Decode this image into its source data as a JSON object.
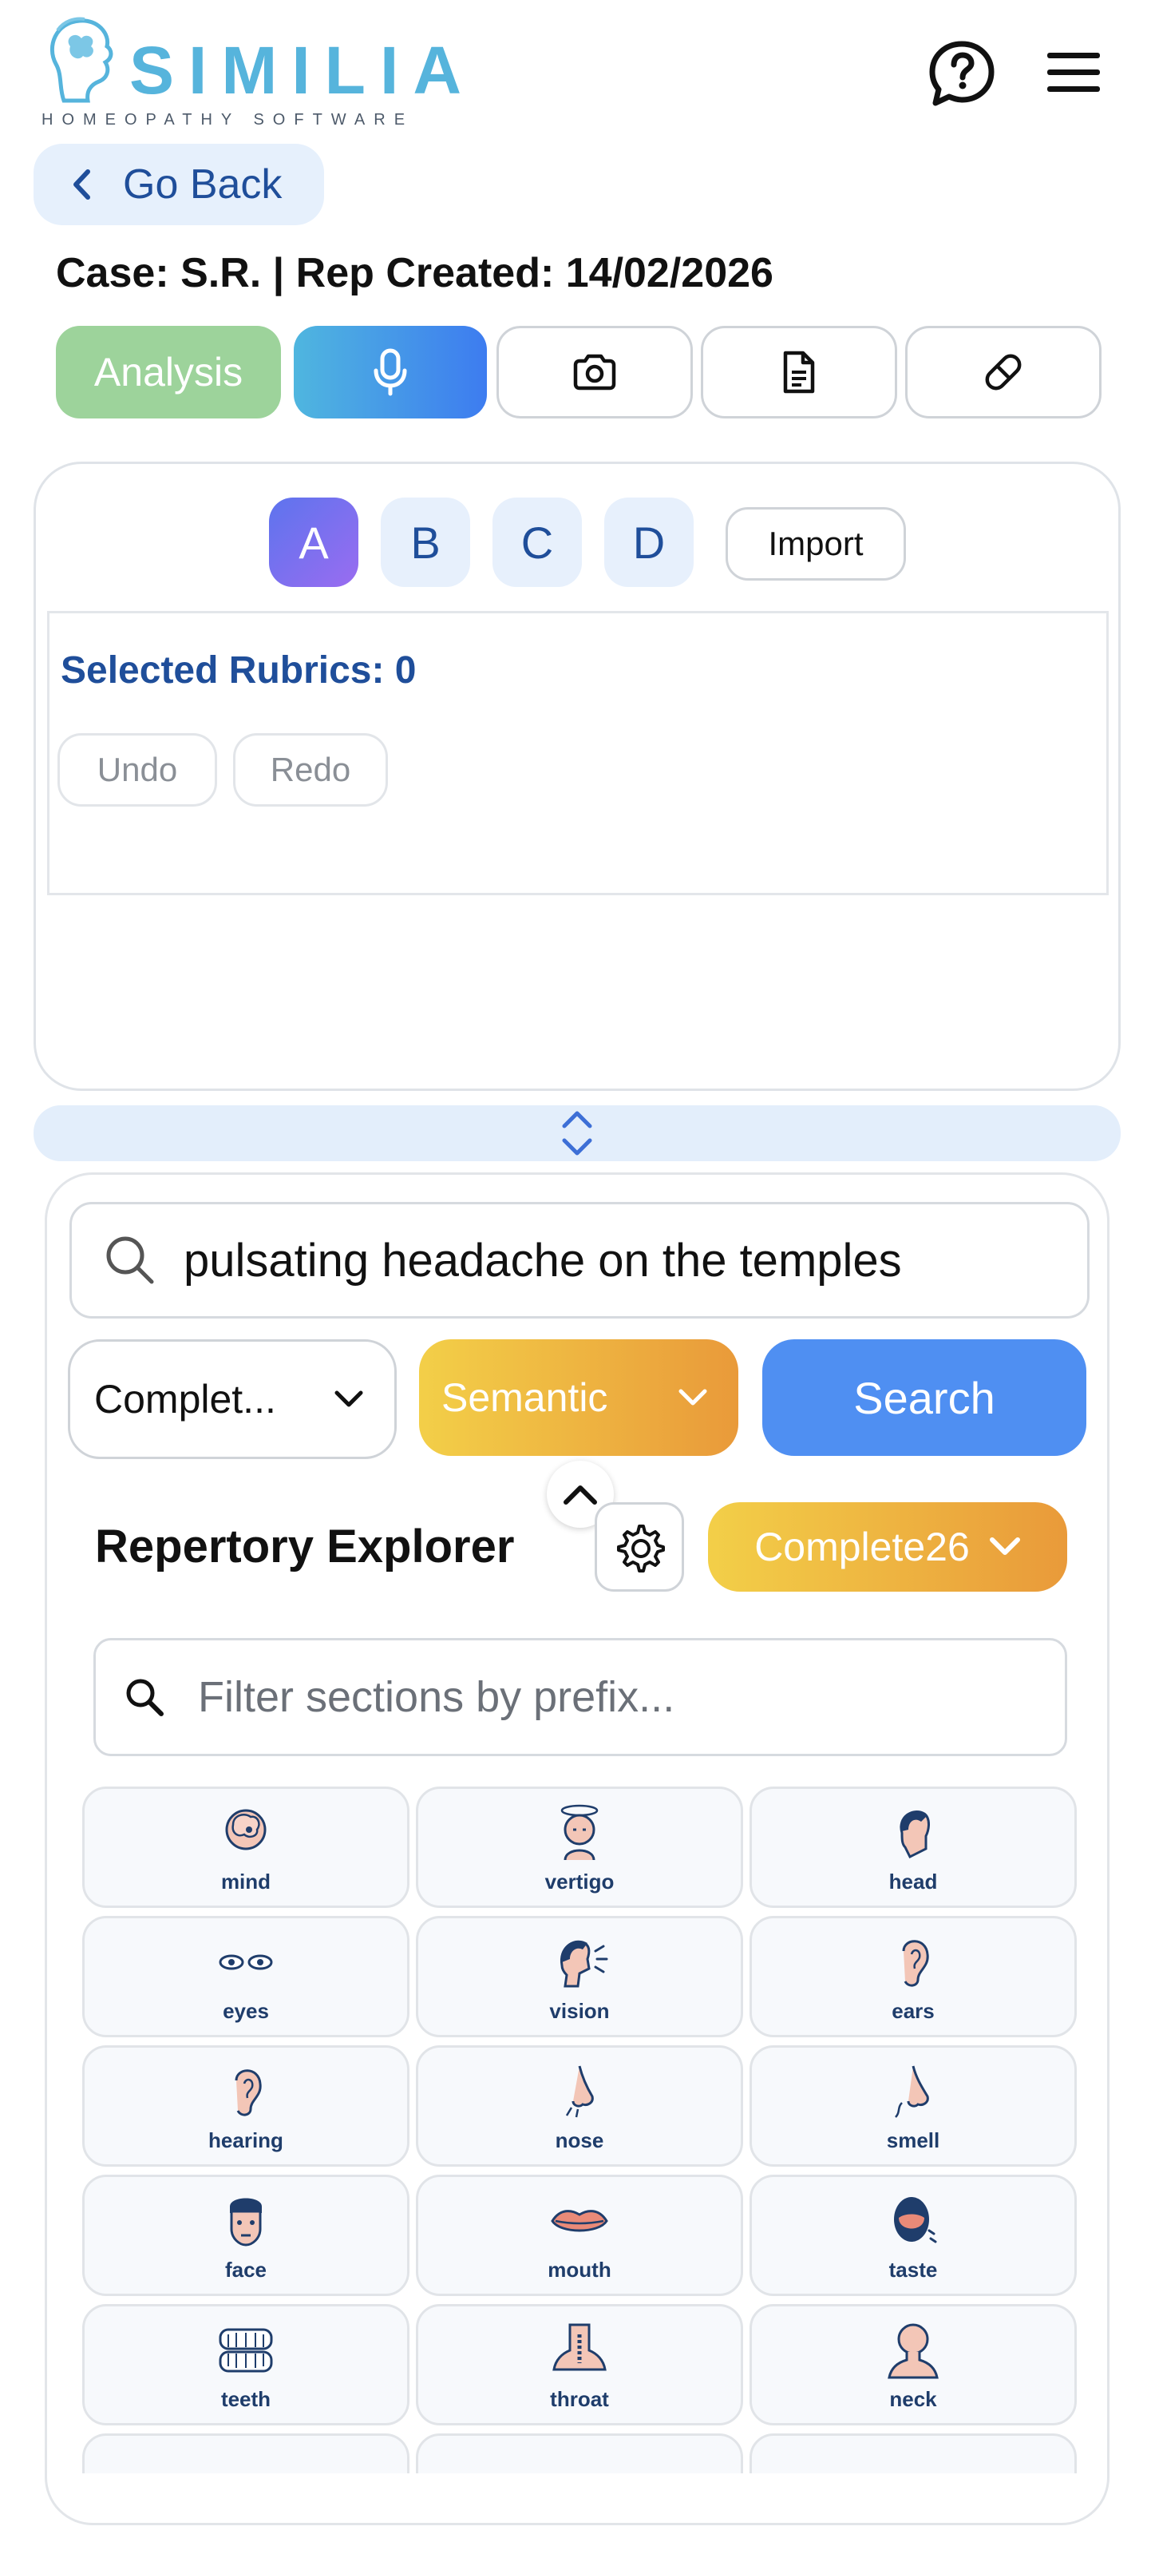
{
  "header": {
    "brand": "SIMILIA",
    "tagline": "HOMEOPATHY SOFTWARE",
    "back_label": "Go Back"
  },
  "case": {
    "line": "Case: S.R. | Rep Created: 14/02/2026"
  },
  "toolbar": {
    "analysis_label": "Analysis"
  },
  "tabs": [
    "A",
    "B",
    "C",
    "D"
  ],
  "import_label": "Import",
  "rubrics": {
    "title": "Selected Rubrics: 0",
    "undo": "Undo",
    "redo": "Redo"
  },
  "search": {
    "query": "pulsating headache on the temples",
    "repertory_select": "Complet...",
    "mode_select": "Semantic",
    "button": "Search"
  },
  "explorer": {
    "title": "Repertory Explorer",
    "repertory": "Complete26",
    "filter_placeholder": "Filter sections by prefix..."
  },
  "sections": [
    {
      "label": "mind",
      "icon": "head-brain-icon"
    },
    {
      "label": "vertigo",
      "icon": "dizzy-head-icon"
    },
    {
      "label": "head",
      "icon": "head-profile-icon"
    },
    {
      "label": "eyes",
      "icon": "eyes-icon"
    },
    {
      "label": "vision",
      "icon": "vision-head-icon"
    },
    {
      "label": "ears",
      "icon": "ear-icon"
    },
    {
      "label": "hearing",
      "icon": "hearing-ear-icon"
    },
    {
      "label": "nose",
      "icon": "nose-icon"
    },
    {
      "label": "smell",
      "icon": "smell-nose-icon"
    },
    {
      "label": "face",
      "icon": "face-icon"
    },
    {
      "label": "mouth",
      "icon": "lips-icon"
    },
    {
      "label": "taste",
      "icon": "tongue-icon"
    },
    {
      "label": "teeth",
      "icon": "teeth-icon"
    },
    {
      "label": "throat",
      "icon": "throat-icon"
    },
    {
      "label": "neck",
      "icon": "neck-icon"
    },
    {
      "label": "",
      "icon": "stomach-icon"
    },
    {
      "label": "",
      "icon": "chest-icon"
    },
    {
      "label": "",
      "icon": "intestine-icon"
    }
  ],
  "colors": {
    "brand_blue": "#56b4dc",
    "primary": "#4f8ff2",
    "accent_gold": "#f0b440",
    "analysis_green": "#9dd39b",
    "text_blue": "#1f4e9a"
  }
}
